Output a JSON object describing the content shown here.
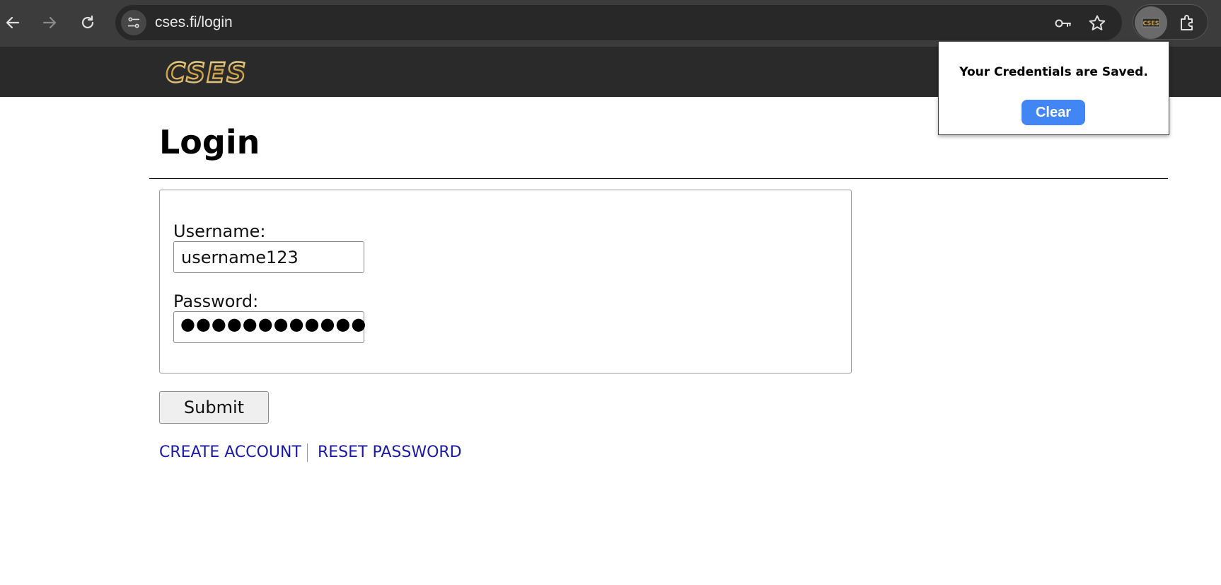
{
  "browser": {
    "url": "cses.fi/login",
    "icons": [
      "back-icon",
      "forward-icon",
      "reload-icon",
      "site-info-icon",
      "key-icon",
      "star-icon",
      "extension-icon",
      "puzzle-icon"
    ]
  },
  "site": {
    "logo_text": "CSES"
  },
  "page": {
    "title": "Login",
    "username_label": "Username:",
    "username_value": "username123",
    "password_label": "Password:",
    "password_dots": "●●●●●●●●●●●●",
    "submit_label": "Submit",
    "create_account": "CREATE ACCOUNT",
    "reset_password": "RESET PASSWORD"
  },
  "popup": {
    "message": "Your Credentials are Saved.",
    "clear_label": "Clear",
    "accent": "#4285f4"
  },
  "colors": {
    "chrome": "#3c3c3c",
    "header": "#2a2a2a",
    "link": "#1a1aa6",
    "logo_gold": "#d4b15a"
  }
}
